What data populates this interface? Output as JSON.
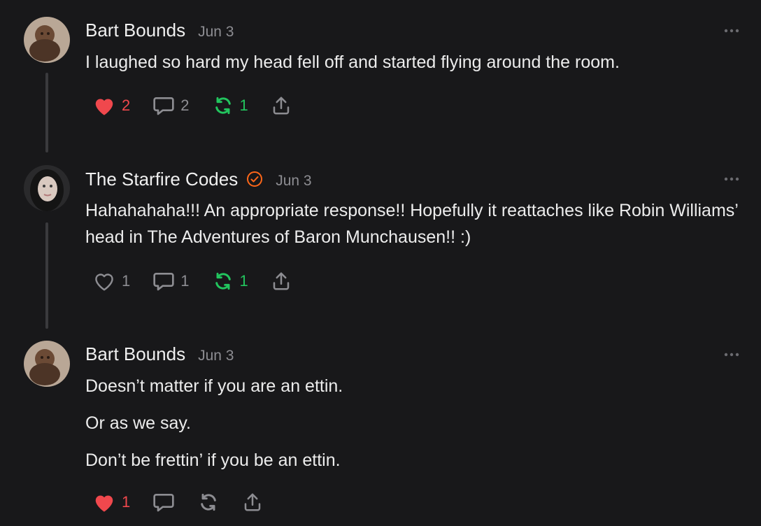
{
  "posts": [
    {
      "author": "Bart Bounds",
      "date": "Jun 3",
      "verified": false,
      "lines": [
        "I laughed so hard my head fell off and started flying around the room."
      ],
      "likes": "2",
      "liked": true,
      "comments": "2",
      "restacks": "1",
      "restacked": true
    },
    {
      "author": "The Starfire Codes",
      "date": "Jun 3",
      "verified": true,
      "lines": [
        "Hahahahaha!!! An appropriate response!! Hopefully it reattaches like Robin Williams’ head in The Adventures of Baron Munchausen!! :)"
      ],
      "likes": "1",
      "liked": false,
      "comments": "1",
      "restacks": "1",
      "restacked": true
    },
    {
      "author": "Bart Bounds",
      "date": "Jun 3",
      "verified": false,
      "lines": [
        "Doesn’t matter if you are an ettin.",
        "Or as we say.",
        "Don’t be frettin’ if you be an ettin."
      ],
      "likes": "1",
      "liked": true,
      "comments": "",
      "restacks": "",
      "restacked": false
    }
  ],
  "colors": {
    "like": "#f0484d",
    "restack": "#22c55e",
    "muted": "#8d8d92",
    "verified": "#ff6719"
  },
  "icons": [
    "heart-icon",
    "comment-icon",
    "restack-icon",
    "share-icon",
    "more-icon",
    "verified-icon"
  ]
}
